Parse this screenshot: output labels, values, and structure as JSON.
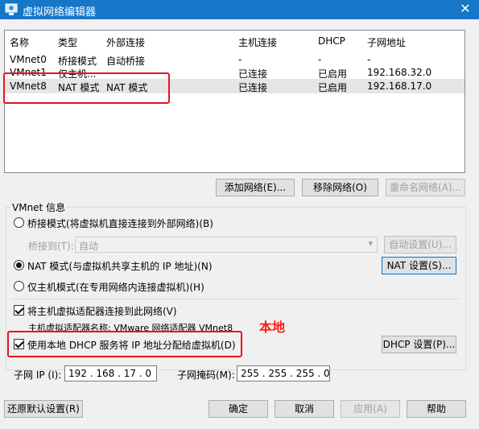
{
  "window": {
    "title": "虚拟网络编辑器",
    "close": "✕"
  },
  "columns": [
    "名称",
    "类型",
    "外部连接",
    "主机连接",
    "DHCP",
    "子网地址"
  ],
  "networks": [
    {
      "name": "VMnet0",
      "type": "桥接模式",
      "external": "自动桥接",
      "host": "-",
      "dhcp": "-",
      "subnet": "-"
    },
    {
      "name": "VMnet1",
      "type": "仅主机...",
      "external": "-",
      "host": "已连接",
      "dhcp": "已启用",
      "subnet": "192.168.32.0"
    },
    {
      "name": "VMnet8",
      "type": "NAT 模式",
      "external": "NAT 模式",
      "host": "已连接",
      "dhcp": "已启用",
      "subnet": "192.168.17.0"
    }
  ],
  "list_buttons": {
    "add": "添加网络(E)...",
    "remove": "移除网络(O)",
    "rename": "重命名网络(A)..."
  },
  "vmnet_info": {
    "label": "VMnet 信息",
    "bridge_mode": "桥接模式(将虚拟机直接连接到外部网络)(B)",
    "bridge_to_label": "桥接到(T):",
    "bridge_to_value": "自动",
    "auto_settings": "自动设置(U)...",
    "nat_mode": "NAT 模式(与虚拟机共享主机的 IP 地址)(N)",
    "nat_settings": "NAT 设置(S)...",
    "host_only": "仅主机模式(在专用网络内连接虚拟机)(H)",
    "connect_adapter": "将主机虚拟适配器连接到此网络(V)",
    "adapter_name": "主机虚拟适配器名称: VMware 网络适配器 VMnet8",
    "use_dhcp": "使用本地 DHCP 服务将 IP 地址分配给虚拟机(D)",
    "dhcp_settings": "DHCP 设置(P)...",
    "subnet_ip_label": "子网 IP (I):",
    "subnet_ip": "192 . 168 . 17 . 0",
    "subnet_mask_label": "子网掩码(M):",
    "subnet_mask": "255 . 255 . 255 . 0"
  },
  "annotation": "本地",
  "footer": {
    "restore": "还原默认设置(R)",
    "ok": "确定",
    "cancel": "取消",
    "apply": "应用(A)",
    "help": "帮助"
  },
  "colors": {
    "titlebar": "#1677c8",
    "highlight": "#e8141c",
    "selected_row": "#e5e5e5"
  }
}
